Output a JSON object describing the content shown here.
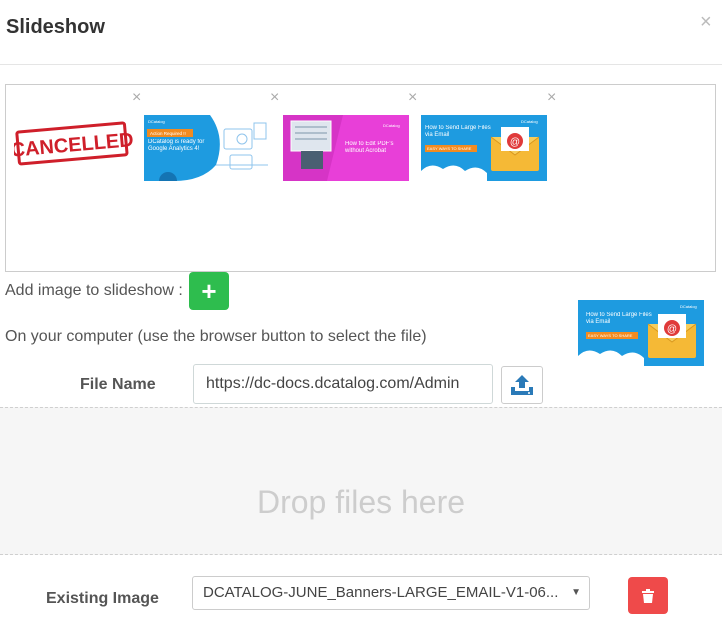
{
  "modal": {
    "title": "Slideshow",
    "close_glyph": "×"
  },
  "gallery": {
    "remove_glyph": "×",
    "images": [
      {
        "name": "cancelled-stamp",
        "stamp_text": "CANCELLED",
        "removable": false
      },
      {
        "name": "banner-google-analytics",
        "brand": "DCatalog",
        "badge": "Action Required !!",
        "text": "DCatalog is ready for Google Analytics 4!",
        "removable": true
      },
      {
        "name": "banner-edit-pdfs",
        "brand": "DCatalog",
        "text": "How to Edit PDF's without Acrobat",
        "removable": true
      },
      {
        "name": "banner-large-files",
        "brand": "DCatalog",
        "text": "How to Send Large Files via Email",
        "badge": "EASY WAYS TO SHARE",
        "removable": true
      }
    ]
  },
  "add_image": {
    "label": "Add image to slideshow :",
    "button_glyph": "+"
  },
  "computer": {
    "label": "On your computer (use the browser button to select the file)"
  },
  "preview": {
    "brand": "DCatalog",
    "text": "How to Send Large Files via Email",
    "badge": "EASY WAYS TO SHARE"
  },
  "file": {
    "label": "File Name",
    "value": "https://dc-docs.dcatalog.com/Admin"
  },
  "dropzone": {
    "text": "Drop files here"
  },
  "existing": {
    "label": "Existing Image",
    "selected": "DCATALOG-JUNE_Banners-LARGE_EMAIL-V1-06..."
  },
  "colors": {
    "add": "#2ebd4e",
    "delete": "#ef4a4a",
    "upload_icon": "#2a7ab8",
    "banner_blue": "#1e9be0",
    "banner_pink": "#e83fd8"
  }
}
